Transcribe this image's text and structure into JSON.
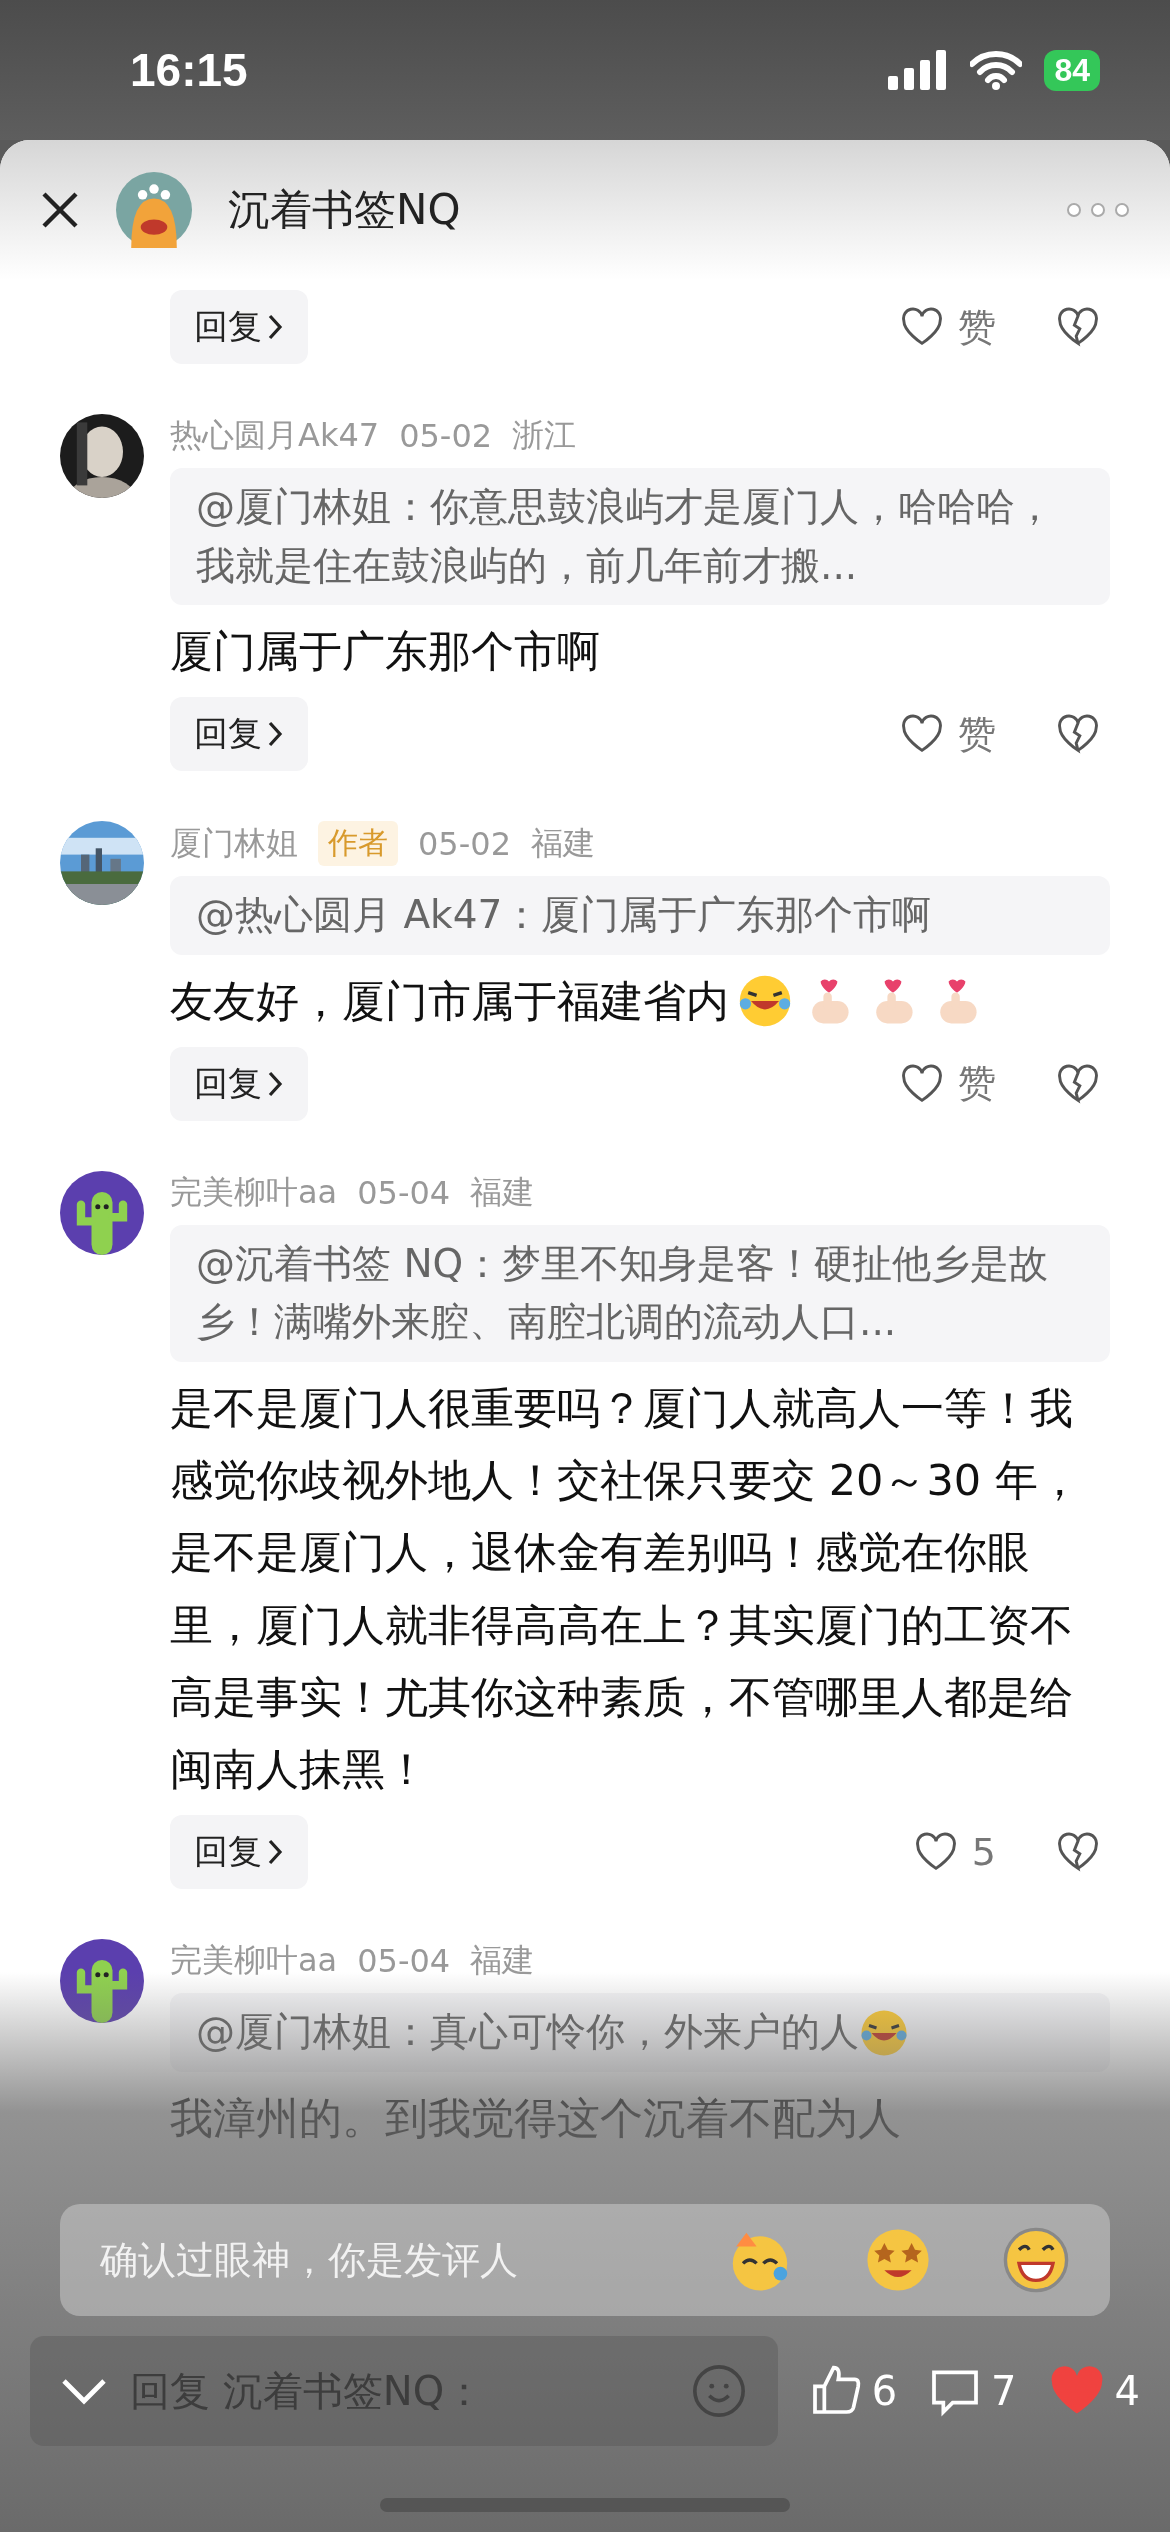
{
  "status_bar": {
    "time": "16:15",
    "battery": "84"
  },
  "header": {
    "title": "沉着书签NQ"
  },
  "top_actions": {
    "reply": "回复",
    "like": "赞"
  },
  "comments": [
    {
      "name": "热心圆月Ak47",
      "date": "05-02",
      "region": "浙江",
      "quote": "@厦门林姐：你意思鼓浪屿才是厦门人，哈哈哈，我就是住在鼓浪屿的，前几年前才搬...",
      "body": "厦门属于广东那个市啊",
      "reply": "回复",
      "like": "赞"
    },
    {
      "avatar": {
        "kind": "city"
      },
      "name": "厦门林姐",
      "badge": "作者",
      "date": "05-02",
      "region": "福建",
      "quote": "@热心圆月 Ak47：厦门属于广东那个市啊",
      "body": "友友好，厦门市属于福建省内",
      "emojis": [
        {
          "kind": "laugh"
        },
        {
          "kind": "finger-heart"
        },
        {
          "kind": "finger-heart"
        },
        {
          "kind": "finger-heart"
        }
      ],
      "reply": "回复",
      "like": "赞"
    },
    {
      "avatar": {
        "kind": "cactus"
      },
      "name": "完美柳叶aa",
      "date": "05-04",
      "region": "福建",
      "quote": "@沉着书签 NQ：梦里不知身是客！硬扯他乡是故乡！满嘴外来腔、南腔北调的流动人口...",
      "body": "是不是厦门人很重要吗？厦门人就高人一等！我感觉你歧视外地人！交社保只要交 20～30 年，是不是厦门人，退休金有差别吗！感觉在你眼里，厦门人就非得高高在上？其实厦门的工资不高是事实！尤其你这种素质，不管哪里人都是给闽南人抹黑！",
      "reply": "回复",
      "like": "5"
    },
    {
      "avatar": {
        "kind": "cactus"
      },
      "name": "完美柳叶aa",
      "date": "05-04",
      "region": "福建",
      "quote": "@厦门林姐：真心可怜你，外来户的人",
      "quote_emojis": [
        {
          "kind": "laugh"
        }
      ],
      "body": "我漳州的。到我觉得这个沉着不配为人"
    }
  ],
  "quick_comment": {
    "text": "确认过眼神，你是发评人",
    "emojis": [
      {
        "kind": "party"
      },
      {
        "kind": "star-eyes"
      },
      {
        "kind": "grin"
      }
    ]
  },
  "input": {
    "placeholder": "回复 沉着书签NQ："
  },
  "actions": [
    {
      "kind": "like",
      "count": "6"
    },
    {
      "kind": "comment",
      "count": "7"
    },
    {
      "kind": "heart",
      "count": "4"
    }
  ]
}
